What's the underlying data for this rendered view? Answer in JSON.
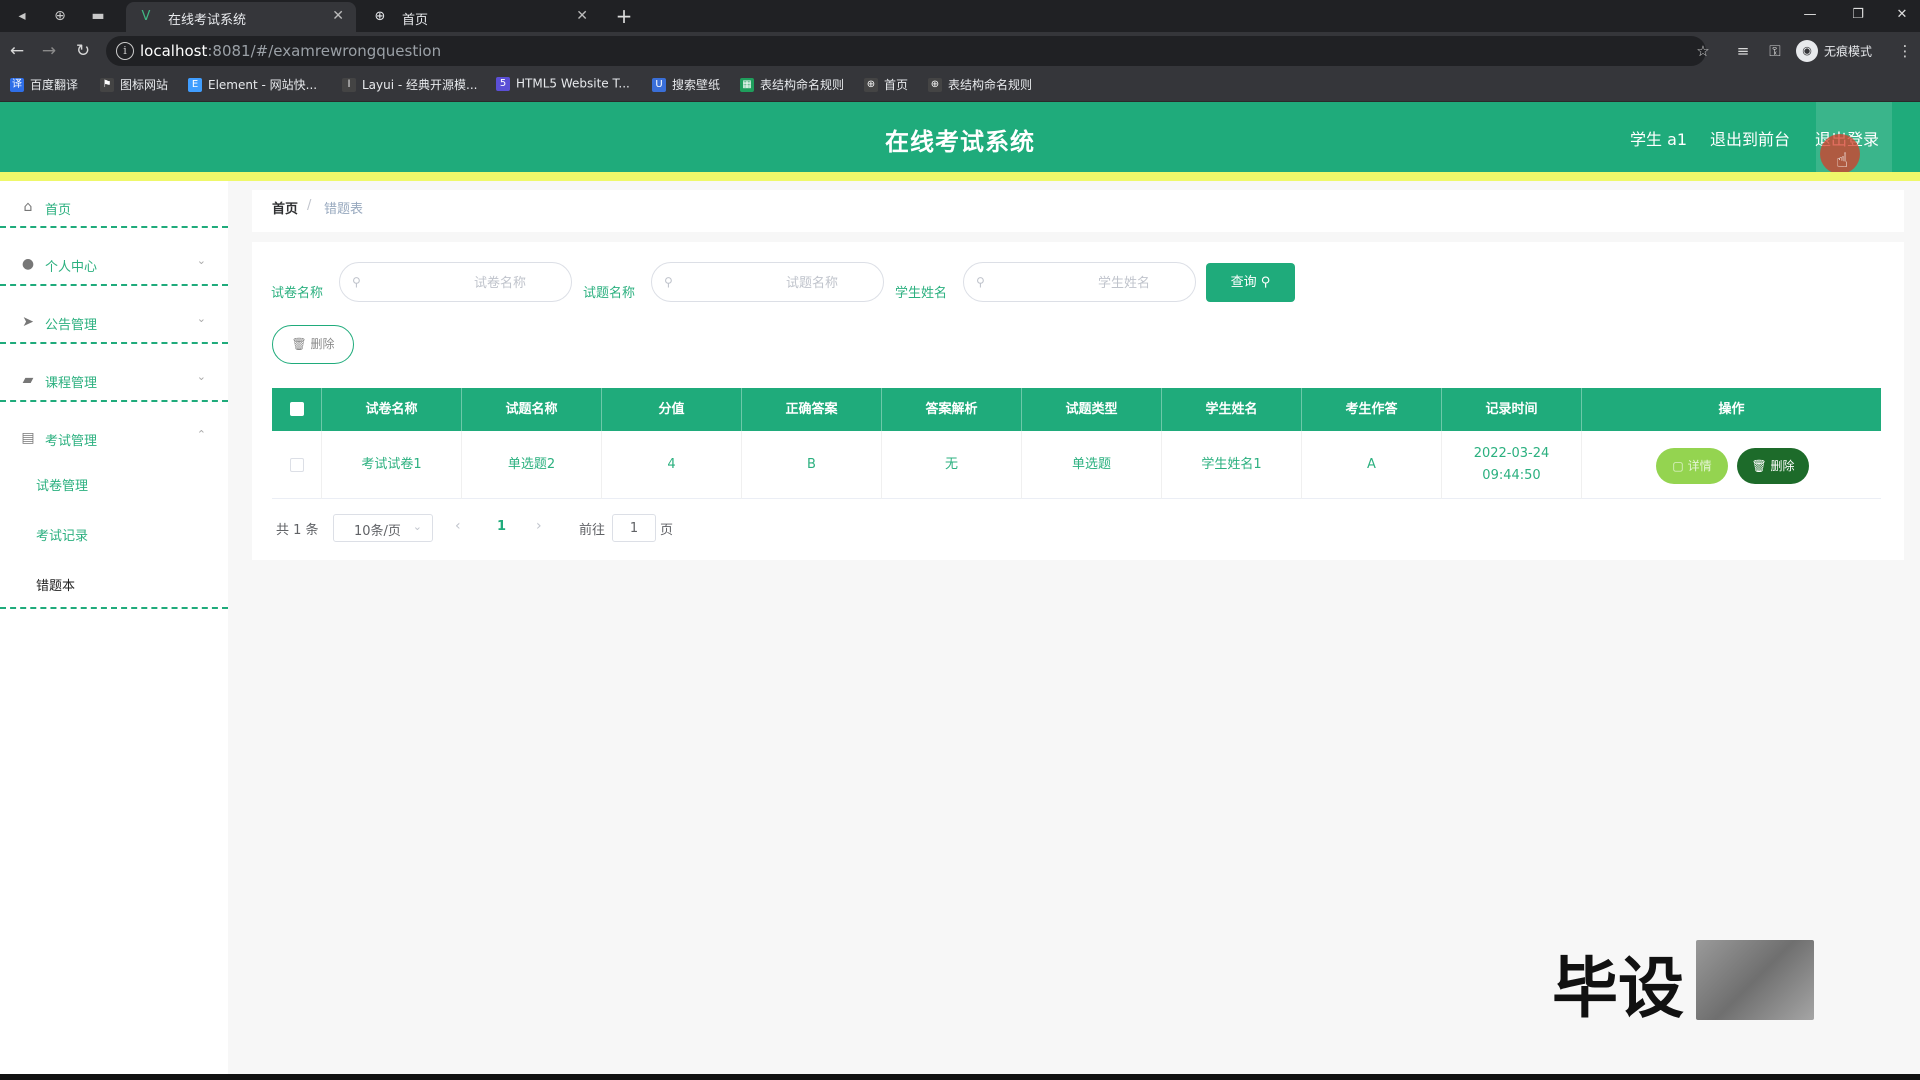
{
  "browser": {
    "tabs": [
      {
        "title": "在线考试系统",
        "icon": "vue-logo-icon",
        "active": true
      },
      {
        "title": "首页",
        "icon": "globe-icon",
        "active": false
      }
    ],
    "url_host": "localhost",
    "url_rest": ":8081/#/examrewrongquestion",
    "incognito_label": "无痕模式",
    "bookmarks": [
      {
        "label": "百度翻译",
        "icon": "translate-icon",
        "color": "#2f6fe8"
      },
      {
        "label": "图标网站",
        "icon": "flag-icon",
        "color": "#444444"
      },
      {
        "label": "Element - 网站快...",
        "icon": "element-icon",
        "color": "#409eff"
      },
      {
        "label": "Layui - 经典开源模...",
        "icon": "layui-icon",
        "color": "#444444"
      },
      {
        "label": "HTML5 Website T...",
        "icon": "html5-icon",
        "color": "#5b4fd6"
      },
      {
        "label": "搜索壁纸",
        "icon": "wallpaper-icon",
        "color": "#3a6fd8"
      },
      {
        "label": "表结构命名规则",
        "icon": "table-icon",
        "color": "#1f9e5c"
      },
      {
        "label": "首页",
        "icon": "globe-icon",
        "color": "#444444"
      },
      {
        "label": "表结构命名规则",
        "icon": "globe-icon",
        "color": "#444444"
      }
    ]
  },
  "header": {
    "title": "在线考试系统",
    "user": "学生 a1",
    "back_to_front": "退出到前台",
    "logout": "退出登录",
    "color": "#1fab7b",
    "strip_color": "#eff86a"
  },
  "sidebar": {
    "items": [
      {
        "label": "首页",
        "icon": "home-icon"
      },
      {
        "label": "个人中心",
        "icon": "user-icon",
        "arrow": "chevron-down-icon"
      },
      {
        "label": "公告管理",
        "icon": "send-icon",
        "arrow": "chevron-down-icon"
      },
      {
        "label": "课程管理",
        "icon": "briefcase-icon",
        "arrow": "chevron-down-icon"
      },
      {
        "label": "考试管理",
        "icon": "folder-icon",
        "arrow": "chevron-up-icon"
      }
    ],
    "subitems": [
      {
        "label": "试卷管理"
      },
      {
        "label": "考试记录"
      },
      {
        "label": "错题本",
        "active": true
      }
    ]
  },
  "breadcrumb": {
    "home": "首页",
    "separator": "/",
    "current": "错题表"
  },
  "search": {
    "paper_label": "试卷名称",
    "paper_placeholder": "试卷名称",
    "question_label": "试题名称",
    "question_placeholder": "试题名称",
    "student_label": "学生姓名",
    "student_placeholder": "学生姓名",
    "query_button": "查询 ⚲"
  },
  "actions": {
    "delete_button": "🗑 删除"
  },
  "table": {
    "columns": [
      "试卷名称",
      "试题名称",
      "分值",
      "正确答案",
      "答案解析",
      "试题类型",
      "学生姓名",
      "考生作答",
      "记录时间",
      "操作"
    ],
    "rows": [
      {
        "paper": "考试试卷1",
        "question": "单选题2",
        "score": "4",
        "correct": "B",
        "analysis": "无",
        "type": "单选题",
        "student": "学生姓名1",
        "answer": "A",
        "time": "2022-03-24 09:44:50",
        "detail_label": "▢ 详情",
        "delete_label": "🗑 删除"
      }
    ]
  },
  "pagination": {
    "total": "共 1 条",
    "page_size": "10条/页",
    "current": "1",
    "goto_prefix": "前往",
    "goto_value": "1",
    "goto_suffix": "页"
  },
  "watermark": {
    "text": "毕设"
  }
}
